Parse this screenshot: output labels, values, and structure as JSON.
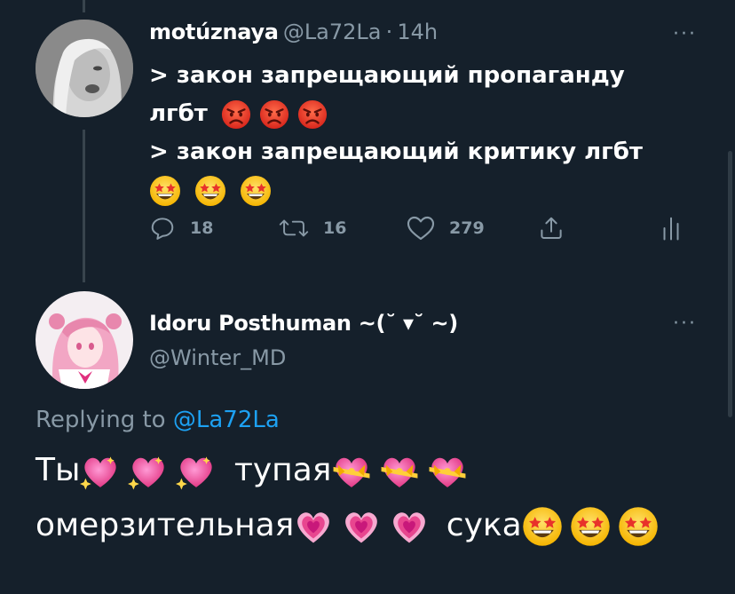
{
  "tweet1": {
    "display_name": "motúznaya",
    "handle": "@La72La",
    "separator": "·",
    "time": "14h",
    "more": "···",
    "line1": "> закон запрещающий пропаганду",
    "line2": "лгбт",
    "line3": "> закон запрещающий критику лгбт",
    "replies": "18",
    "retweets": "16",
    "likes": "279"
  },
  "tweet2": {
    "display_name": "Idoru Posthuman ~(˘ ▾˘ ~)",
    "handle": "@Winter_MD",
    "more": "···",
    "replying_prefix": "Replying to",
    "replying_handle": "@La72La",
    "word1": "Ты",
    "word2": "тупая",
    "word3": "омерзительная",
    "word4": "сука"
  },
  "colors": {
    "background": "#15202b",
    "secondary_text": "#8899a6",
    "link": "#1da1f2",
    "thread_line": "#38444d"
  },
  "icons": {
    "angry": "pouting-face-emoji",
    "star_struck": "star-struck-emoji",
    "sparkling_heart": "sparkling-heart-emoji",
    "heart_ribbon": "heart-with-ribbon-emoji",
    "growing_heart": "growing-heart-emoji"
  }
}
